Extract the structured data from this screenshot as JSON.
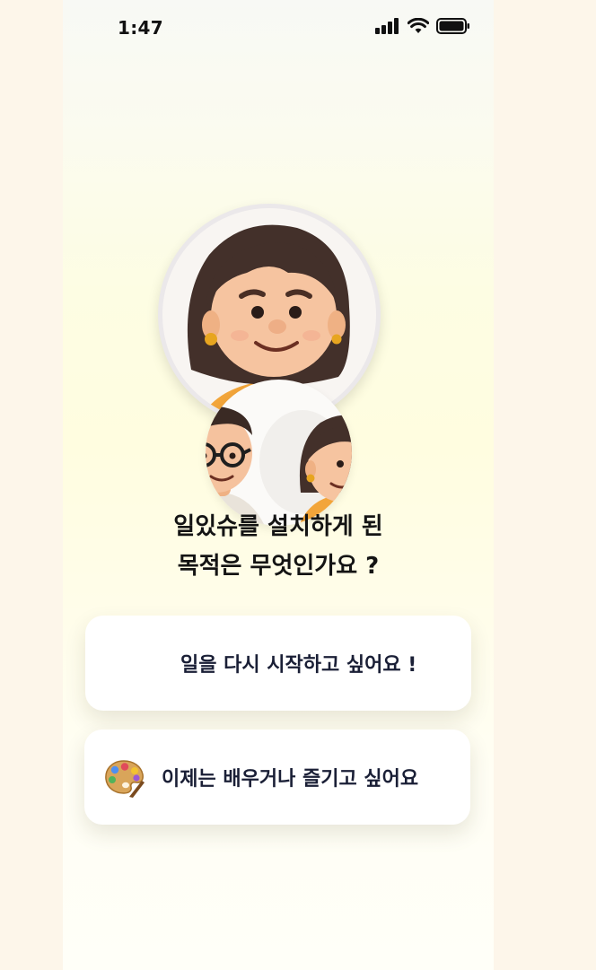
{
  "status_bar": {
    "time": "1:47",
    "icons": [
      "cellular-signal-icon",
      "wifi-icon",
      "battery-icon"
    ]
  },
  "avatars": {
    "main": "woman-avatar",
    "secondary": [
      "man-with-glasses-avatar",
      "woman-avatar"
    ]
  },
  "question": {
    "line1": "일있슈를 설치하게 된",
    "line2": "목적은 무엇인가요 ?"
  },
  "options": [
    {
      "label": "일을 다시 시작하고 싶어요 !",
      "icon": ""
    },
    {
      "label": "이제는 배우거나 즐기고 싶어요",
      "icon": "artist-palette-icon"
    }
  ],
  "colors": {
    "page_background": "#fdf6ea",
    "card_background": "#ffffff",
    "option_text": "#1a1f36",
    "question_text": "#141414"
  }
}
